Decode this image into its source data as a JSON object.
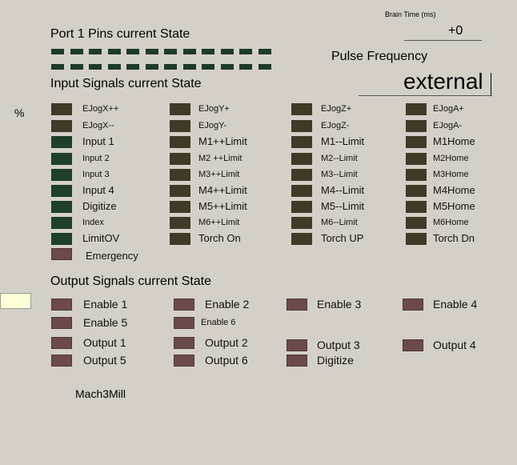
{
  "header": {
    "port_title": "Port 1 Pins current State",
    "brain_time_label": "Brain Time (ms)",
    "brain_time_value": "+0",
    "pulse_frequency_label": "Pulse Frequency",
    "pulse_frequency_value": "external",
    "percent_sign": "%"
  },
  "input_section": {
    "title": "Input Signals current State",
    "columns": [
      [
        "EJogX++",
        "EJogX--",
        "Input 1",
        "Input 2",
        "Input 3",
        "Input 4",
        "Digitize",
        "Index",
        "LimitOV",
        "Emergency"
      ],
      [
        "EJogY+",
        "EJogY-",
        "M1++Limit",
        "M2 ++Limit",
        "M3++Limit",
        "M4++Limit",
        "M5++Limit",
        "M6++Limit",
        "Torch On"
      ],
      [
        "EJogZ+",
        "EJogZ-",
        "M1--Limit",
        "M2--Limit",
        "M3--Limit",
        "M4--Limit",
        "M5--Limit",
        "M6--Limit",
        "Torch UP"
      ],
      [
        "EJogA+",
        "EJogA-",
        "M1Home",
        "M2Home",
        "M3Home",
        "M4Home",
        "M5Home",
        "M6Home",
        "Torch Dn"
      ]
    ]
  },
  "output_section": {
    "title": "Output Signals current State",
    "rows": [
      [
        "Enable 1",
        "Enable 2",
        "Enable 3",
        "Enable 4"
      ],
      [
        "Enable 5",
        "Enable 6"
      ],
      [
        "Output 1",
        "Output 2",
        "Output 3",
        "Output 4"
      ],
      [
        "Output 5",
        "Output 6",
        "Digitize"
      ]
    ]
  },
  "footer": {
    "profile_name": "Mach3Mill"
  }
}
